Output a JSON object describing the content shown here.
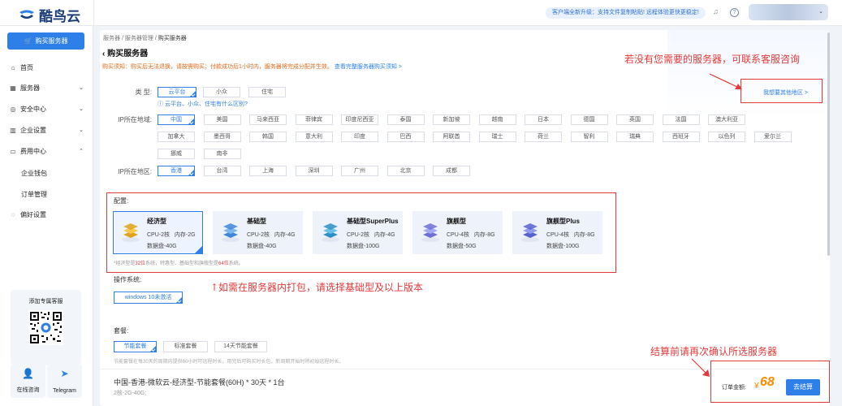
{
  "header": {
    "logo_text": "酷鸟云",
    "notice": "客户端全新升级：支持文件复制粘贴! 远程体验更快更稳定!"
  },
  "sidebar": {
    "buy_label": "购买服务器",
    "items": [
      {
        "label": "首页",
        "icon": "home-icon"
      },
      {
        "label": "服务器",
        "icon": "server-icon",
        "chevron": "down"
      },
      {
        "label": "安全中心",
        "icon": "shield-icon",
        "chevron": "down"
      },
      {
        "label": "企业设置",
        "icon": "building-icon",
        "chevron": "down"
      },
      {
        "label": "费用中心",
        "icon": "wallet-icon",
        "chevron": "up"
      }
    ],
    "subitems": [
      "企业钱包",
      "订单管理"
    ],
    "prefs_label": "偏好设置",
    "promo_title": "添加专属客服",
    "contact_online": "在线咨询",
    "contact_telegram": "Telegram"
  },
  "breadcrumb": {
    "items": [
      "服务器",
      "服务器管理"
    ],
    "current": "购买服务器",
    "separator": "/"
  },
  "page": {
    "title": "购买服务器",
    "back_icon": "chevron-left-icon",
    "tip": "购买须知：购买后无法退换，请按需购买；付款成功后1小时内，服务器将完成分配并生效。",
    "tip_link": "查看完整服务器购买须知 >"
  },
  "filters": {
    "type_label": "类  型:",
    "types": [
      "云平台",
      "小众",
      "住宅"
    ],
    "type_help": "云平台、小众、住宅有什么区别?",
    "country_label": "IP所在地域:",
    "countries_row1": [
      "中国",
      "美国",
      "马来西亚",
      "菲律宾",
      "印度尼西亚",
      "泰国",
      "新加坡",
      "越南",
      "日本",
      "德国",
      "英国",
      "法国",
      "澳大利亚"
    ],
    "countries_row2": [
      "加拿大",
      "墨西哥",
      "韩国",
      "意大利",
      "印度",
      "巴西",
      "阿联酋",
      "瑞士",
      "荷兰",
      "智利",
      "瑞典",
      "西班牙",
      "以色列",
      "爱尔兰"
    ],
    "countries_row3": [
      "挪威",
      "南非"
    ],
    "region_label": "IP所在地区:",
    "regions": [
      "香港",
      "台湾",
      "上海",
      "深圳",
      "广州",
      "北京",
      "成都"
    ],
    "other_region": "我想要其他地区 >"
  },
  "config": {
    "label": "配置:",
    "plans": [
      {
        "name": "经济型",
        "cpu": "CPU-2核",
        "ram": "内存-2G",
        "disk": "数据盘-40G",
        "selected": true
      },
      {
        "name": "基础型",
        "cpu": "CPU-2核",
        "ram": "内存-4G",
        "disk": "数据盘-40G"
      },
      {
        "name": "基础型SuperPlus",
        "cpu": "CPU-2核",
        "ram": "内存-4G",
        "disk": "数据盘-100G"
      },
      {
        "name": "旗舰型",
        "cpu": "CPU-4核",
        "ram": "内存-8G",
        "disk": "数据盘-50G"
      },
      {
        "name": "旗舰型Plus",
        "cpu": "CPU-4核",
        "ram": "内存-8G",
        "disk": "数据盘-100G"
      }
    ],
    "note_pre": "*经济型是",
    "note_hl1": "32位",
    "note_mid": "系统，特惠型、基础型和旗舰型是",
    "note_hl2": "64位",
    "note_post": "系统。"
  },
  "os": {
    "label": "操作系统:",
    "value": "windows 10未激活"
  },
  "package": {
    "label": "套餐:",
    "options": [
      "节能套餐",
      "标准套餐",
      "14天节能套餐"
    ],
    "note": "节能套餐在每30天的周期内提供60小时可远程时长，用完后可购买时长包，新周期开始时将初始远程时长。"
  },
  "summary": {
    "title": "中国-香港-微软云-经济型-节能套餐(60H) * 30天 * 1台",
    "subtitle": "2核-2G-40G;",
    "total_label": "订单金额:",
    "currency": "¥",
    "total": "68",
    "pay_label": "去结算"
  },
  "annotations": {
    "contact_note": "若没有您需要的服务器，可联系客服咨询",
    "pack_note": "↑如需在服务器内打包，请选择基础型及以上版本",
    "confirm_note": "结算前请再次确认所选服务器",
    "color": "#e23a3a"
  },
  "colors": {
    "accent": "#2f7fe8",
    "price": "#ff8a00",
    "warning": "#e06a1a"
  }
}
